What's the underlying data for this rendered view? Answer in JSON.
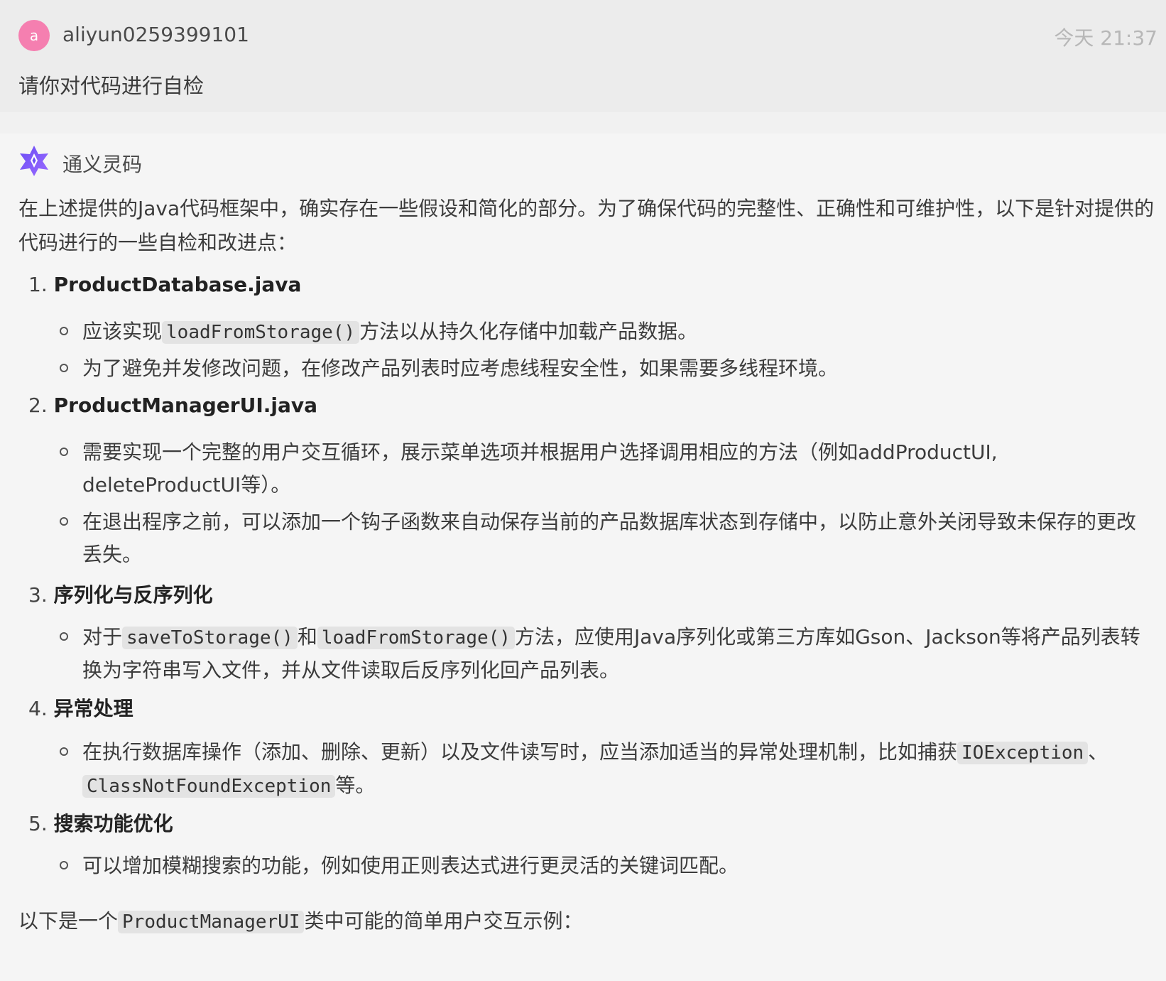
{
  "user_message": {
    "avatar_letter": "a",
    "username": "aliyun0259399101",
    "timestamp": "今天 21:37",
    "text": "请你对代码进行自检"
  },
  "bot": {
    "name": "通义灵码",
    "intro": "在上述提供的Java代码框架中，确实存在一些假设和简化的部分。为了确保代码的完整性、正确性和可维护性，以下是针对提供的代码进行的一些自检和改进点：",
    "sections": [
      {
        "number": "1.",
        "title": "ProductDatabase.java",
        "b1_pre": "应该实现",
        "b1_code": "loadFromStorage()",
        "b1_post": "方法以从持久化存储中加载产品数据。",
        "b2": "为了避免并发修改问题，在修改产品列表时应考虑线程安全性，如果需要多线程环境。"
      },
      {
        "number": "2.",
        "title": "ProductManagerUI.java",
        "b1": "需要实现一个完整的用户交互循环，展示菜单选项并根据用户选择调用相应的方法（例如addProductUI, deleteProductUI等）。",
        "b2": "在退出程序之前，可以添加一个钩子函数来自动保存当前的产品数据库状态到存储中，以防止意外关闭导致未保存的更改丢失。"
      },
      {
        "number": "3.",
        "title": "序列化与反序列化",
        "b1_pre": "对于",
        "b1_code1": "saveToStorage()",
        "b1_mid": "和",
        "b1_code2": "loadFromStorage()",
        "b1_post": "方法，应使用Java序列化或第三方库如Gson、Jackson等将产品列表转换为字符串写入文件，并从文件读取后反序列化回产品列表。"
      },
      {
        "number": "4.",
        "title": "异常处理",
        "b1_pre": "在执行数据库操作（添加、删除、更新）以及文件读写时，应当添加适当的异常处理机制，比如捕获",
        "b1_code1": "IOException",
        "b1_mid": "、",
        "b1_code2": "ClassNotFoundException",
        "b1_post": "等。"
      },
      {
        "number": "5.",
        "title": "搜索功能优化",
        "b1": "可以增加模糊搜索的功能，例如使用正则表达式进行更灵活的关键词匹配。"
      }
    ],
    "outro_pre": "以下是一个",
    "outro_code": "ProductManagerUI",
    "outro_post": "类中可能的简单用户交互示例："
  }
}
